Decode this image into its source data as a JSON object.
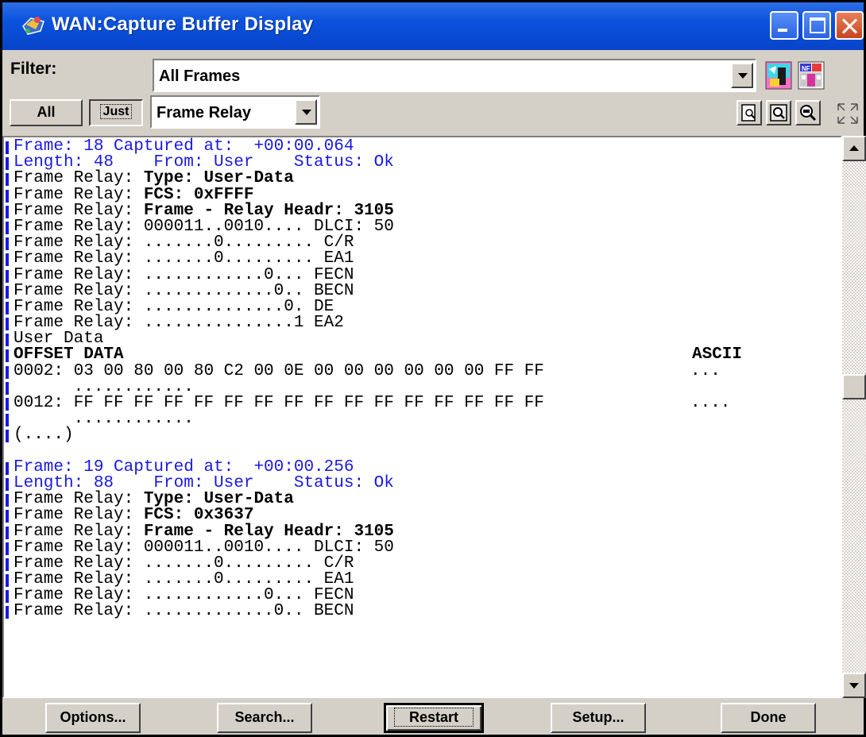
{
  "window": {
    "title": "WAN:Capture Buffer Display"
  },
  "filter": {
    "label": "Filter:",
    "value": "All Frames"
  },
  "toolbar": {
    "all_label": "All",
    "just_label": "Just",
    "protocol_value": "Frame Relay"
  },
  "capture_lines": [
    {
      "text": "Frame: 18 Captured at:  +00:00.064",
      "blue": true
    },
    {
      "text": "Length: 48    From: User    Status: Ok",
      "blue": true
    },
    {
      "prefix": "Frame Relay: ",
      "bold": "Type: User-Data"
    },
    {
      "prefix": "Frame Relay: ",
      "bold": "FCS: 0xFFFF"
    },
    {
      "prefix": "Frame Relay: ",
      "bold": "Frame - Relay Headr: 3105"
    },
    {
      "text": "Frame Relay: 000011..0010.... DLCI: 50"
    },
    {
      "text": "Frame Relay: .......0......... C/R"
    },
    {
      "text": "Frame Relay: .......0......... EA1"
    },
    {
      "text": "Frame Relay: ............0... FECN"
    },
    {
      "text": "Frame Relay: .............0.. BECN"
    },
    {
      "text": "Frame Relay: ..............0. DE"
    },
    {
      "text": "Frame Relay: ...............1 EA2"
    },
    {
      "text": "User Data"
    },
    {
      "header": "OFFSET DATA",
      "ascii_header": "ASCII"
    },
    {
      "text": "0002: 03 00 80 00 80 C2 00 0E 00 00 00 00 00 00 FF FF",
      "ascii": "..."
    },
    {
      "text": "      ............",
      "nomark": false
    },
    {
      "text": "0012: FF FF FF FF FF FF FF FF FF FF FF FF FF FF FF FF",
      "ascii": "...."
    },
    {
      "text": "      ............",
      "nomark": false
    },
    {
      "text": "(....)"
    },
    {
      "blank": true
    },
    {
      "text": "Frame: 19 Captured at:  +00:00.256",
      "blue": true
    },
    {
      "text": "Length: 88    From: User    Status: Ok",
      "blue": true
    },
    {
      "prefix": "Frame Relay: ",
      "bold": "Type: User-Data"
    },
    {
      "prefix": "Frame Relay: ",
      "bold": "FCS: 0x3637"
    },
    {
      "prefix": "Frame Relay: ",
      "bold": "Frame - Relay Headr: 3105"
    },
    {
      "text": "Frame Relay: 000011..0010.... DLCI: 50"
    },
    {
      "text": "Frame Relay: .......0......... C/R"
    },
    {
      "text": "Frame Relay: .......0......... EA1"
    },
    {
      "text": "Frame Relay: ............0... FECN"
    },
    {
      "text": "Frame Relay: .............0.. BECN"
    }
  ],
  "buttons": {
    "options": "Options...",
    "search": "Search...",
    "restart": "Restart",
    "setup": "Setup...",
    "done": "Done"
  },
  "colors": {
    "title_bar": "#0a52dd",
    "frame_text": "#1919e0",
    "window_face": "#d4d0c8"
  },
  "icons": [
    "wan-app-icon",
    "filter-tool-icon",
    "filter-pattern-icon",
    "zoom-page-icon",
    "zoom-in-icon",
    "zoom-out-icon",
    "expand-icon"
  ]
}
